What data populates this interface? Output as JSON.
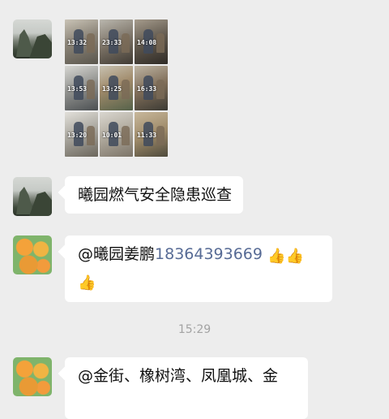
{
  "photo_grid": {
    "timestamps": [
      "13:32",
      "23:33",
      "14:08",
      "13:53",
      "13:25",
      "16:33",
      "13:20",
      "10:01",
      "11:33"
    ]
  },
  "messages": [
    {
      "text": "曦园燃气安全隐患巡查"
    },
    {
      "mention": "@曦园姜鹏",
      "phone": "18364393669",
      "emoji": "👍"
    },
    {
      "text": "@金街、橡树湾、凤凰城、金"
    }
  ],
  "time_divider": "15:29"
}
